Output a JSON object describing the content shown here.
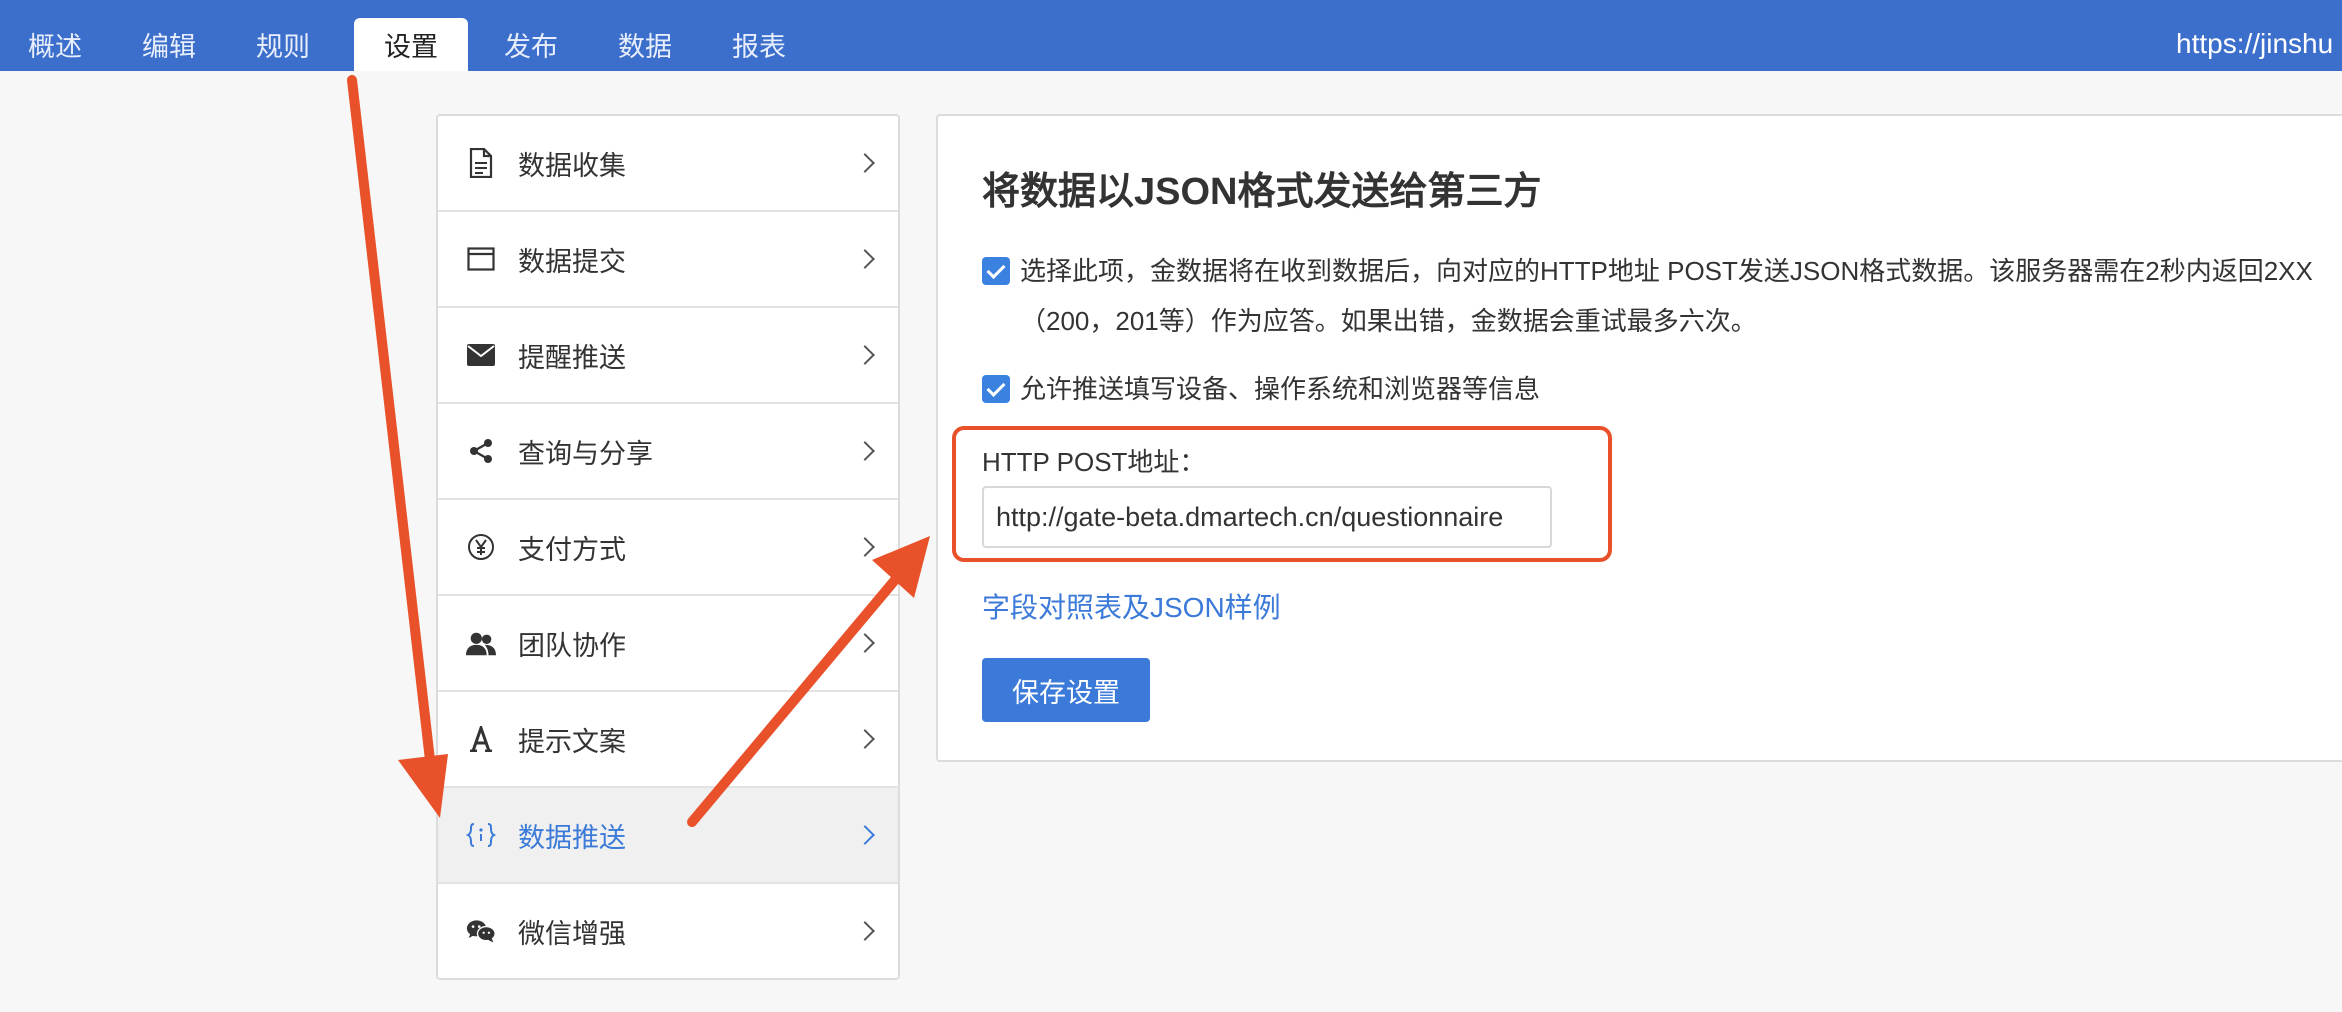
{
  "nav": {
    "tabs": [
      {
        "label": "概述"
      },
      {
        "label": "编辑"
      },
      {
        "label": "规则"
      },
      {
        "label": "设置",
        "active": true
      },
      {
        "label": "发布"
      },
      {
        "label": "数据"
      },
      {
        "label": "报表"
      }
    ],
    "url_partial": "https://jinshu"
  },
  "menu": {
    "items": [
      {
        "label": "数据收集",
        "icon": "document-icon"
      },
      {
        "label": "数据提交",
        "icon": "window-icon"
      },
      {
        "label": "提醒推送",
        "icon": "envelope-icon"
      },
      {
        "label": "查询与分享",
        "icon": "share-icon"
      },
      {
        "label": "支付方式",
        "icon": "yen-icon"
      },
      {
        "label": "团队协作",
        "icon": "users-icon"
      },
      {
        "label": "提示文案",
        "icon": "font-icon"
      },
      {
        "label": "数据推送",
        "icon": "braces-icon",
        "active": true
      },
      {
        "label": "微信增强",
        "icon": "wechat-icon"
      }
    ]
  },
  "panel": {
    "title": "将数据以JSON格式发送给第三方",
    "option1": "选择此项，金数据将在收到数据后，向对应的HTTP地址 POST发送JSON格式数据。该服务器需在2秒内返回2XX（200，201等）作为应答。如果出错，金数据会重试最多六次。",
    "option2": "允许推送填写设备、操作系统和浏览器等信息",
    "url_label": "HTTP POST地址：",
    "url_value": "http://gate-beta.dmartech.cn/questionnaire",
    "link": "字段对照表及JSON样例",
    "save_label": "保存设置"
  },
  "colors": {
    "nav_bg": "#3b6fcb",
    "accent": "#3b7ad9",
    "annotation": "#e8512a"
  }
}
